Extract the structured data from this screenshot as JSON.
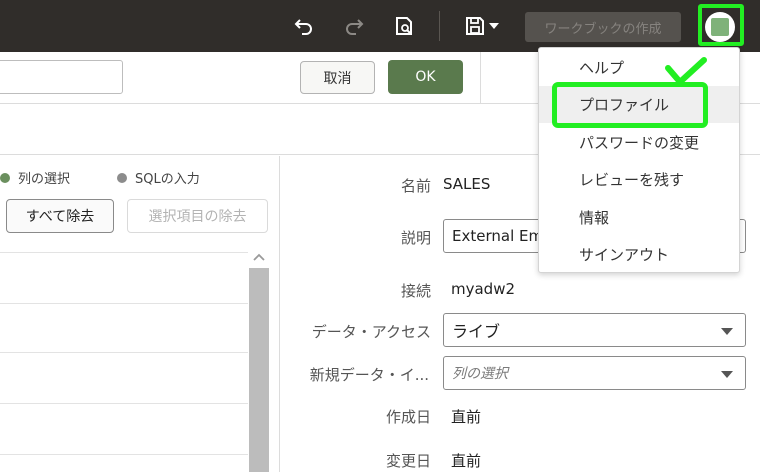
{
  "toolbar": {
    "create_workbook_label": "ワークブックの作成",
    "icons": [
      "undo-icon",
      "redo-icon",
      "preview-icon",
      "save-icon",
      "chevron-down-icon",
      "avatar-icon"
    ]
  },
  "actions": {
    "name_value": "",
    "cancel_label": "取消",
    "ok_label": "OK"
  },
  "left": {
    "radio_columns": "列の選択",
    "radio_sql": "SQLの入力",
    "remove_all_label": "すべて除去",
    "remove_selected_label": "選択項目の除去"
  },
  "form": {
    "name_label": "名前",
    "name_value": "SALES",
    "description_label": "説明",
    "description_value": "External Em",
    "connection_label": "接続",
    "connection_value": "myadw2",
    "data_access_label": "データ・アクセス",
    "data_access_value": "ライブ",
    "new_data_label": "新規データ・イ...",
    "new_data_placeholder": "列の選択",
    "created_label": "作成日",
    "created_value": "直前",
    "modified_label": "変更日",
    "modified_value": "直前"
  },
  "menu": {
    "items": [
      "ヘルプ",
      "プロファイル",
      "パスワードの変更",
      "レビューを残す",
      "情報",
      "サインアウト"
    ]
  },
  "colors": {
    "toolbar_bg": "#302d2a",
    "ok_green": "#5a7a4d",
    "annotation_green": "#22ee22",
    "radio_selected": "#6b8f5e",
    "radio_unselected": "#8c8c8c"
  }
}
